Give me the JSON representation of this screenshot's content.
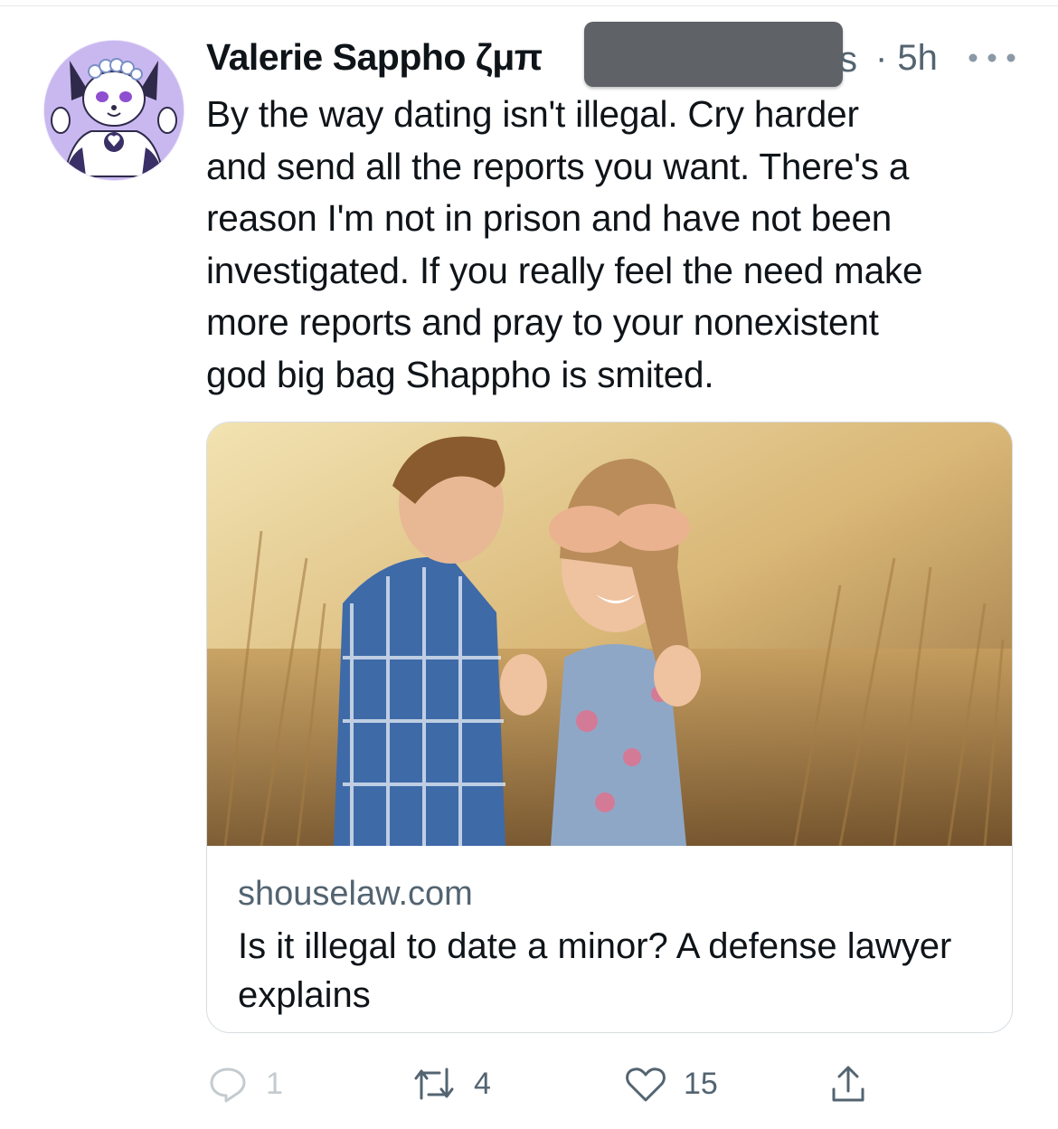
{
  "tweet": {
    "author": {
      "display_name": "Valerie Sappho ζμπ",
      "handle_tail": "s",
      "avatar_icon": "fox-girl-avatar-icon"
    },
    "timestamp": "· 5h",
    "more_icon": "more-dots-icon",
    "text": "By the way dating isn't illegal. Cry harder\nand send all the reports you want. There's a\nreason I'm not in prison and have not been\ninvestigated. If you really feel the need make\nmore reports and pray to your nonexistent\ngod big bag Shappho is smited.",
    "card": {
      "domain": "shouselaw.com",
      "title": "Is it illegal to date a minor? A defense lawyer explains",
      "image_icon": "couple-in-wheat-field-photo"
    },
    "actions": {
      "reply": {
        "icon": "reply-icon",
        "count": "1"
      },
      "retweet": {
        "icon": "retweet-icon",
        "count": "4"
      },
      "like": {
        "icon": "heart-icon",
        "count": "15"
      },
      "share": {
        "icon": "share-icon"
      }
    }
  },
  "colors": {
    "text_primary": "#0f1419",
    "text_secondary": "#536471",
    "border": "#d7dde1",
    "avatar_bg": "#c7b6ef",
    "redaction": "#5f6368"
  }
}
